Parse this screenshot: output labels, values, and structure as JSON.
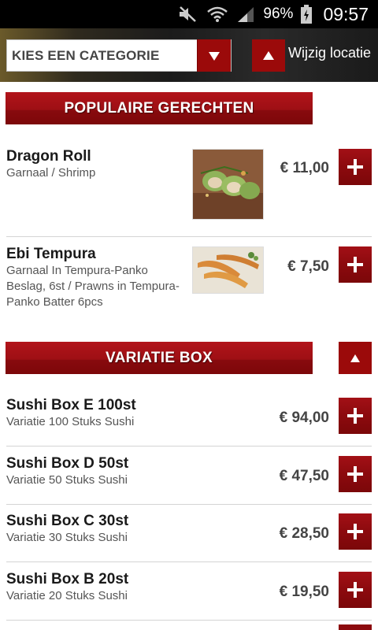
{
  "status_bar": {
    "battery_percent": "96%",
    "time": "09:57"
  },
  "header": {
    "category_select": "KIES EEN CATEGORIE",
    "change_location_label": "Wijzig locatie"
  },
  "sections": [
    {
      "title": "POPULAIRE GERECHTEN",
      "items": [
        {
          "name": "Dragon Roll",
          "description": "Garnaal / Shrimp",
          "price": "€ 11,00",
          "image_icon": "dragon-roll-photo"
        },
        {
          "name": "Ebi Tempura",
          "description": "Garnaal In Tempura-Panko Beslag, 6st / Prawns in Tempura-Panko Batter 6pcs",
          "price": "€ 7,50",
          "image_icon": "ebi-tempura-photo"
        }
      ]
    },
    {
      "title": "VARIATIE BOX",
      "items": [
        {
          "name": "Sushi Box E 100st",
          "description": "Variatie 100 Stuks Sushi",
          "price": "€ 94,00"
        },
        {
          "name": "Sushi Box D 50st",
          "description": "Variatie 50 Stuks Sushi",
          "price": "€ 47,50"
        },
        {
          "name": "Sushi Box C 30st",
          "description": "Variatie 30 Stuks Sushi",
          "price": "€ 28,50"
        },
        {
          "name": "Sushi Box B 20st",
          "description": "Variatie 20 Stuks Sushi",
          "price": "€ 19,50"
        }
      ]
    }
  ],
  "colors": {
    "accent": "#9b0a0a",
    "status_bar": "#000000"
  }
}
